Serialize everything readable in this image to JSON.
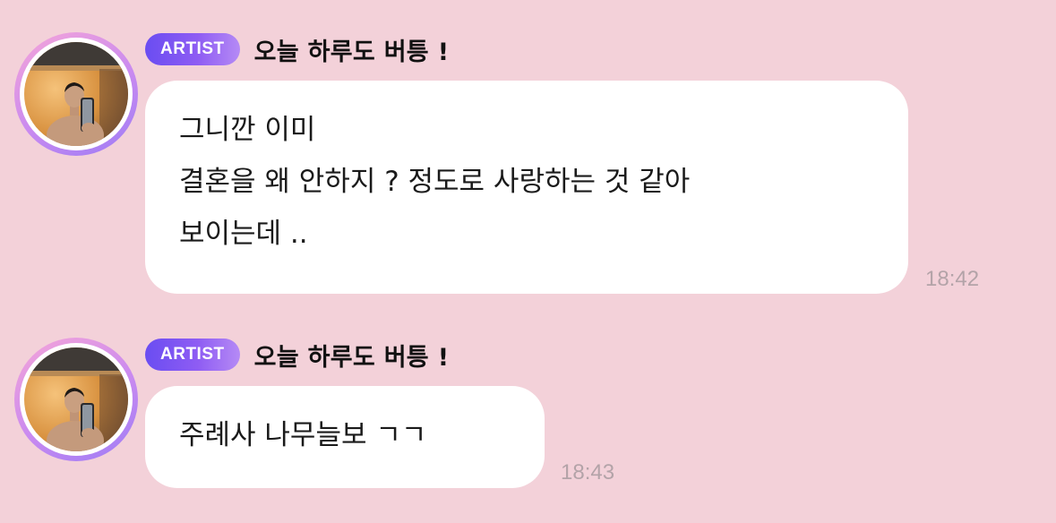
{
  "messages": [
    {
      "badge": "ARTIST",
      "sender": "오늘 하루도 버틍 !",
      "lines": [
        "그니깐 이미",
        "결혼을 왜 안하지 ? 정도로 사랑하는 것 같아",
        "보이는데 .."
      ],
      "time": "18:42"
    },
    {
      "badge": "ARTIST",
      "sender": "오늘 하루도 버틍 !",
      "lines": [
        "주례사 나무늘보 ㄱㄱ"
      ],
      "time": "18:43"
    }
  ],
  "colors": {
    "background": "#f3d1d9",
    "bubble": "#ffffff",
    "badge_start": "#6a4df2",
    "badge_end": "#b58af5",
    "timestamp": "#b3a3a8"
  },
  "icons": {
    "avatar": "profile-photo"
  }
}
